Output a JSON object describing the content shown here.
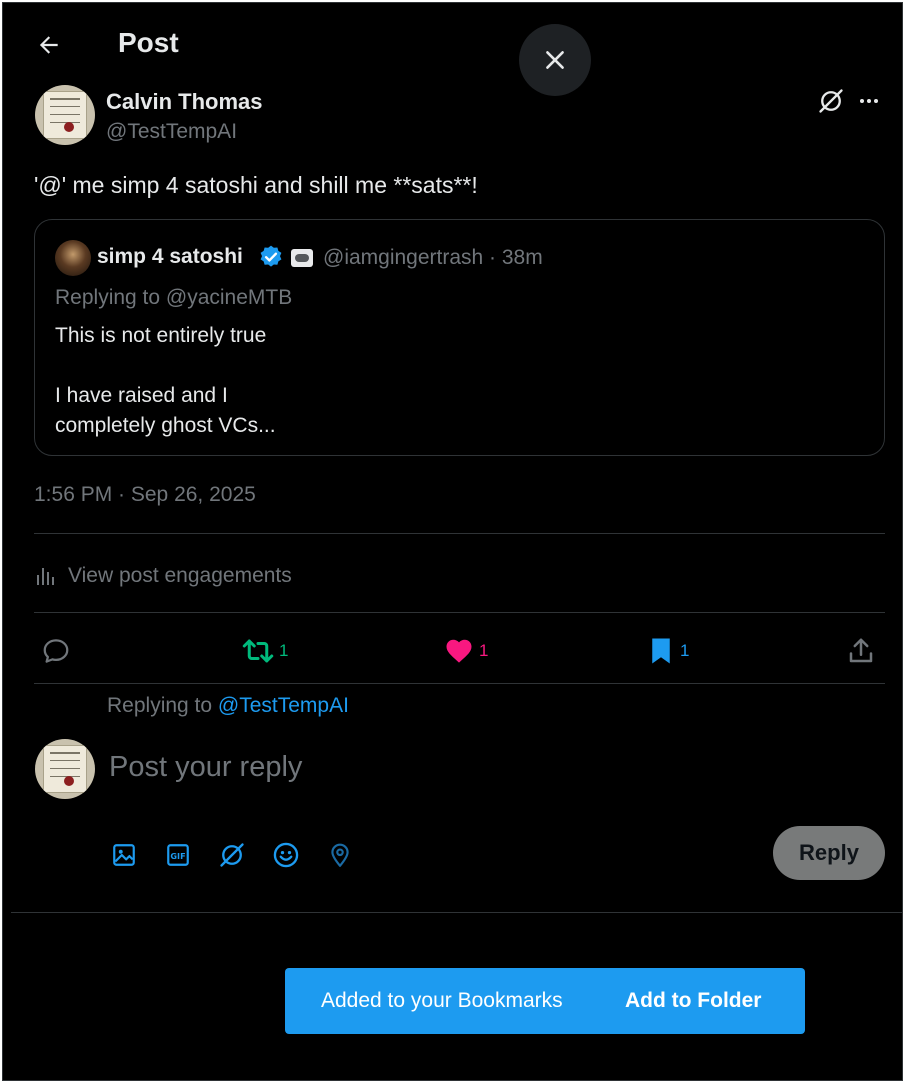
{
  "header": {
    "title": "Post"
  },
  "post": {
    "author_name": "Calvin Thomas",
    "author_handle": "@TestTempAI",
    "text": "'@' me simp 4 satoshi and shill me **sats**!",
    "timestamp": "1:56 PM · Sep 26, 2025"
  },
  "quote": {
    "author_name": "simp 4 satoshi",
    "handle_time": "@iamgingertrash · 38m",
    "replying_to": "Replying to @yacineMTB",
    "body_line1": "This is not entirely true",
    "body_line2": "I have raised and I",
    "body_line3": "completely ghost VCs..."
  },
  "engagements": {
    "label": "View post engagements"
  },
  "actions": {
    "retweets": "1",
    "likes": "1",
    "bookmarks": "1",
    "colors": {
      "retweet": "#00ba7c",
      "like": "#f91880",
      "bookmark": "#1d9bf0",
      "neutral": "#71767b"
    }
  },
  "reply": {
    "replying_prefix": "Replying to",
    "replying_handle": "@TestTempAI",
    "placeholder": "Post your reply",
    "button_label": "Reply"
  },
  "toast": {
    "message": "Added to your Bookmarks",
    "action_label": "Add to Folder"
  }
}
